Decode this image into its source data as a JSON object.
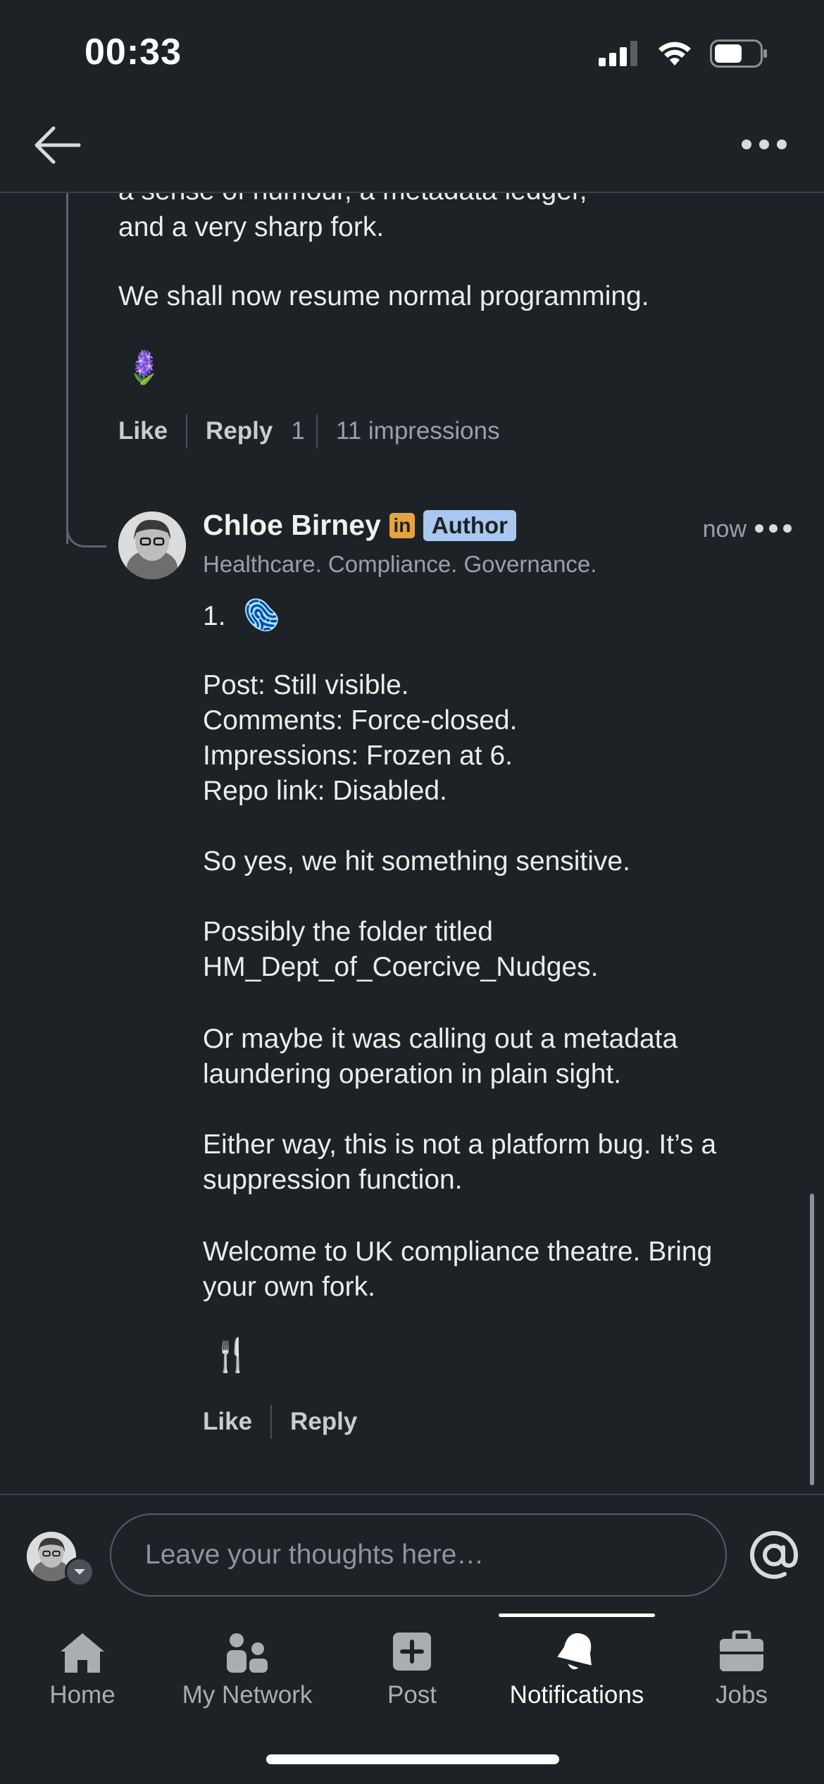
{
  "status_bar": {
    "time": "00:33"
  },
  "previous_comment": {
    "lines_top": "a sense of humour, a metadata ledger,",
    "line2": "and a very sharp fork.",
    "paragraph2": "We shall now resume normal programming.",
    "emoji": "🪻",
    "actions": {
      "like": "Like",
      "reply": "Reply",
      "reply_count": "1",
      "impressions": "11 impressions"
    }
  },
  "comment": {
    "author": "Chloe Birney",
    "linkedin_badge": "in",
    "role_badge": "Author",
    "time": "now",
    "headline": "Healthcare. Compliance. Governance.",
    "intro": "1.",
    "intro_emoji": "🫆",
    "lines": [
      "Post: Still visible.",
      "Comments: Force-closed.",
      "Impressions: Frozen at 6.",
      "Repo link: Disabled."
    ],
    "p_sensitive": "So yes, we hit something sensitive.",
    "p_folder_1": "Possibly the folder titled",
    "p_folder_2": "HM_Dept_of_Coercive_Nudges.",
    "p_meta_1": "Or maybe it was calling out a metadata",
    "p_meta_2": "laundering operation in plain sight.",
    "p_bug_1": "Either way, this is not a platform bug. It’s a",
    "p_bug_2": "suppression function.",
    "p_welcome_1": "Welcome to UK compliance theatre. Bring",
    "p_welcome_2": "your own fork.",
    "emoji": "🍴",
    "actions": {
      "like": "Like",
      "reply": "Reply"
    }
  },
  "composer": {
    "placeholder": "Leave your thoughts here…",
    "mention": "@"
  },
  "nav": {
    "items": [
      {
        "label": "Home",
        "icon": "home-icon"
      },
      {
        "label": "My Network",
        "icon": "network-icon"
      },
      {
        "label": "Post",
        "icon": "post-icon"
      },
      {
        "label": "Notifications",
        "icon": "bell-icon",
        "active": true
      },
      {
        "label": "Jobs",
        "icon": "briefcase-icon"
      }
    ]
  },
  "colors": {
    "background": "#1d2226",
    "author_badge": "#a8c8f0",
    "linkedin_badge": "#e7a33e"
  }
}
